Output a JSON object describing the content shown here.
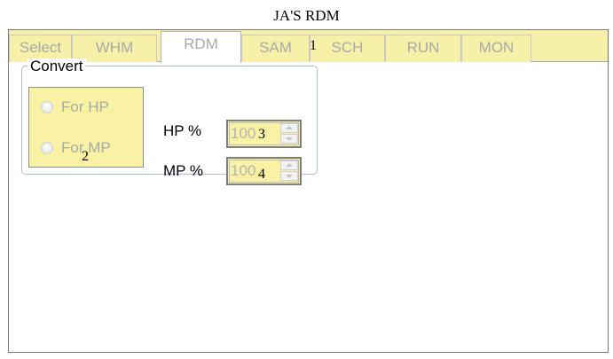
{
  "document": {
    "title": "JA'S RDM"
  },
  "tabs": [
    {
      "label": "Select",
      "active": false,
      "enabled": false
    },
    {
      "label": "WHM",
      "active": false,
      "enabled": false
    },
    {
      "label": "RDM",
      "active": true,
      "enabled": false
    },
    {
      "label": "SAM",
      "active": false,
      "enabled": false
    },
    {
      "label": "SCH",
      "active": false,
      "enabled": false
    },
    {
      "label": "RUN",
      "active": false,
      "enabled": false
    },
    {
      "label": "MON",
      "active": false,
      "enabled": false
    }
  ],
  "convert_group": {
    "legend": "Convert",
    "options": [
      {
        "label": "For HP",
        "checked": false,
        "enabled": false
      },
      {
        "label": "For MP",
        "checked": false,
        "enabled": false
      }
    ],
    "hp_label": "HP %",
    "hp_value": "100",
    "mp_label": "MP %",
    "mp_value": "100"
  },
  "markers": {
    "tabs": "1",
    "radio_panel": "2",
    "hp_spinner": "3",
    "mp_spinner": "4"
  },
  "colors": {
    "highlight_yellow": "#f6f0a8",
    "disabled_text": "#a9a9a9",
    "group_border": "#a9bcd8"
  }
}
